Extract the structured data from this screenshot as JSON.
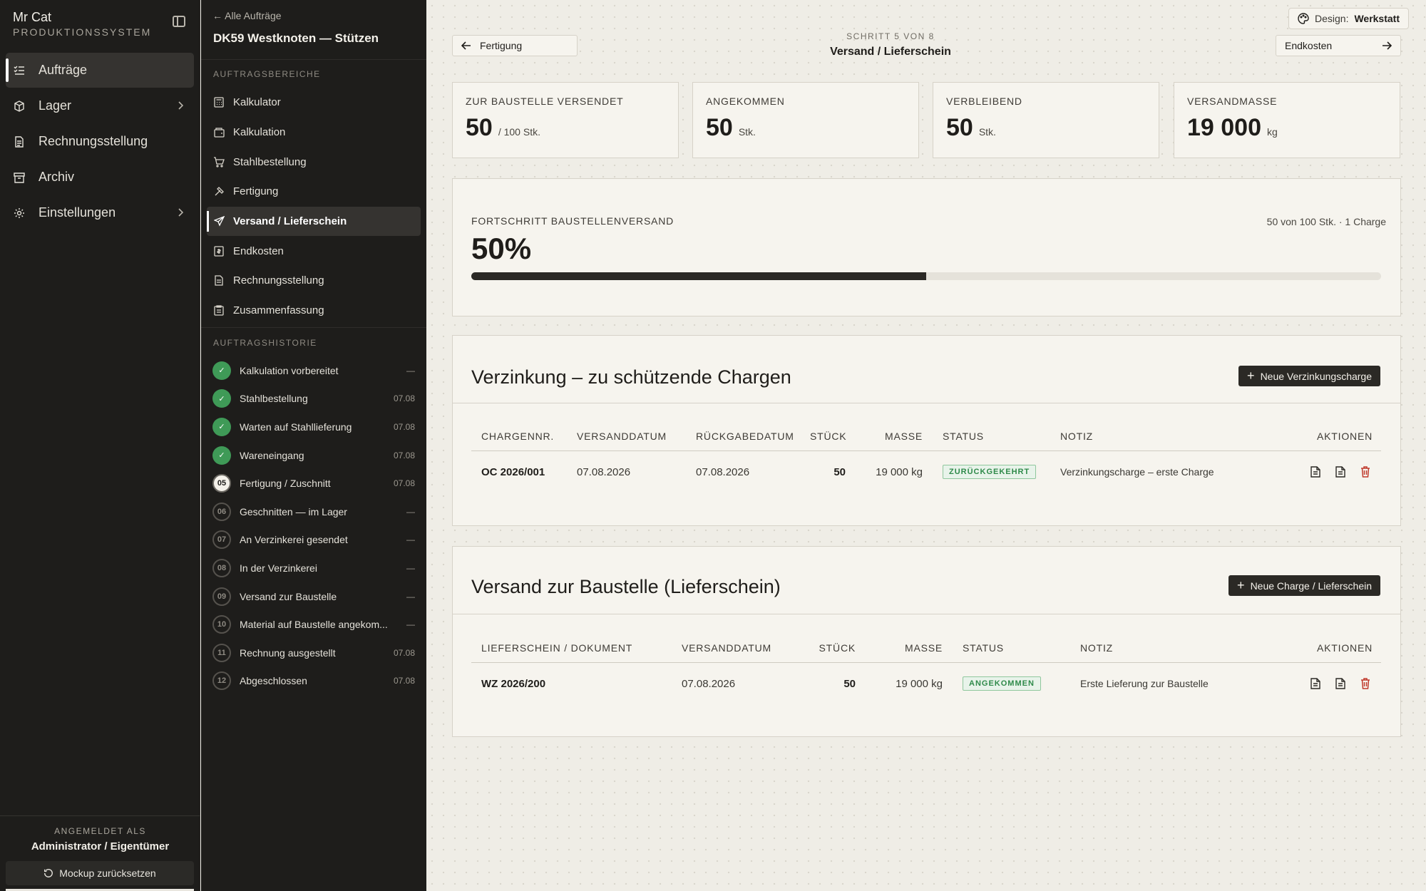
{
  "app": {
    "name": "Mr Cat",
    "subtitle": "PRODUKTIONSSYSTEM"
  },
  "nav": {
    "items": [
      {
        "label": "Aufträge",
        "icon": "list-check-icon",
        "active": true
      },
      {
        "label": "Lager",
        "icon": "box-icon",
        "has_children": true
      },
      {
        "label": "Rechnungsstellung",
        "icon": "document-icon"
      },
      {
        "label": "Archiv",
        "icon": "archive-icon"
      },
      {
        "label": "Einstellungen",
        "icon": "gear-icon",
        "has_children": true
      }
    ]
  },
  "footer": {
    "logged_in_label": "ANGEMELDET ALS",
    "user": "Administrator / Eigentümer",
    "reset_label": "Mockup zurücksetzen"
  },
  "order": {
    "back_label": "Alle Aufträge",
    "title": "DK59 Westknoten — Stützen",
    "areas_heading": "AUFTRAGSBEREICHE",
    "areas": [
      {
        "label": "Kalkulator",
        "icon": "calculator-icon"
      },
      {
        "label": "Kalkulation",
        "icon": "wallet-icon"
      },
      {
        "label": "Stahlbestellung",
        "icon": "cart-icon"
      },
      {
        "label": "Fertigung",
        "icon": "hammer-icon"
      },
      {
        "label": "Versand / Lieferschein",
        "icon": "send-icon",
        "active": true
      },
      {
        "label": "Endkosten",
        "icon": "receipt-icon"
      },
      {
        "label": "Rechnungsstellung",
        "icon": "document-icon"
      },
      {
        "label": "Zusammenfassung",
        "icon": "clipboard-icon"
      }
    ],
    "history_heading": "AUFTRAGSHISTORIE",
    "history": [
      {
        "badge": "✓",
        "state": "done",
        "label": "Kalkulation vorbereitet",
        "date": "—"
      },
      {
        "badge": "✓",
        "state": "done",
        "label": "Stahlbestellung",
        "date": "07.08"
      },
      {
        "badge": "✓",
        "state": "done",
        "label": "Warten auf Stahllieferung",
        "date": "07.08"
      },
      {
        "badge": "✓",
        "state": "done",
        "label": "Wareneingang",
        "date": "07.08"
      },
      {
        "badge": "05",
        "state": "current",
        "label": "Fertigung / Zuschnitt",
        "date": "07.08"
      },
      {
        "badge": "06",
        "state": "pending",
        "label": "Geschnitten — im Lager",
        "date": "—"
      },
      {
        "badge": "07",
        "state": "pending",
        "label": "An Verzinkerei gesendet",
        "date": "—"
      },
      {
        "badge": "08",
        "state": "pending",
        "label": "In der Verzinkerei",
        "date": "—"
      },
      {
        "badge": "09",
        "state": "pending",
        "label": "Versand zur Baustelle",
        "date": "—"
      },
      {
        "badge": "10",
        "state": "pending",
        "label": "Material auf Baustelle angekom...",
        "date": "—"
      },
      {
        "badge": "11",
        "state": "pending",
        "label": "Rechnung ausgestellt",
        "date": "07.08"
      },
      {
        "badge": "12",
        "state": "pending",
        "label": "Abgeschlossen",
        "date": "07.08"
      }
    ]
  },
  "design": {
    "label": "Design:",
    "value": "Werkstatt"
  },
  "stepper": {
    "prev_label": "Fertigung",
    "next_label": "Endkosten",
    "count": "SCHRITT 5 VON 8",
    "name": "Versand / Lieferschein"
  },
  "kpis": [
    {
      "label": "ZUR BAUSTELLE VERSENDET",
      "value": "50",
      "unit": "/ 100 Stk."
    },
    {
      "label": "ANGEKOMMEN",
      "value": "50",
      "unit": "Stk."
    },
    {
      "label": "VERBLEIBEND",
      "value": "50",
      "unit": "Stk."
    },
    {
      "label": "VERSANDMASSE",
      "value": "19 000",
      "unit": "kg"
    }
  ],
  "progress": {
    "label": "FORTSCHRITT BAUSTELLENVERSAND",
    "percent_text": "50%",
    "fraction": 0.5,
    "summary": "50 von 100 Stk. · 1 Charge"
  },
  "galvanizing": {
    "title": "Verzinkung – zu schützende Chargen",
    "button": "Neue Verzinkungscharge",
    "headers": [
      "CHARGENNR.",
      "VERSANDDATUM",
      "RÜCKGABEDATUM",
      "STÜCK",
      "MASSE",
      "STATUS",
      "NOTIZ",
      "AKTIONEN"
    ],
    "rows": [
      {
        "id": "OC 2026/001",
        "ship_date": "07.08.2026",
        "return_date": "07.08.2026",
        "qty": "50",
        "mass": "19 000 kg",
        "status": "ZURÜCKGEKEHRT",
        "note": "Verzinkungscharge – erste Charge"
      }
    ]
  },
  "delivery": {
    "title": "Versand zur Baustelle (Lieferschein)",
    "button": "Neue Charge / Lieferschein",
    "headers": [
      "LIEFERSCHEIN / DOKUMENT",
      "VERSANDDATUM",
      "STÜCK",
      "MASSE",
      "STATUS",
      "NOTIZ",
      "AKTIONEN"
    ],
    "rows": [
      {
        "id": "WZ 2026/200",
        "ship_date": "07.08.2026",
        "qty": "50",
        "mass": "19 000 kg",
        "status": "ANGEKOMMEN",
        "note": "Erste Lieferung zur Baustelle"
      }
    ]
  },
  "colors": {
    "sidebar_bg": "#1e1d1b",
    "main_bg": "#efede6",
    "accent_dark": "#2b2925",
    "success": "#3f9a57",
    "danger": "#c0392b"
  }
}
